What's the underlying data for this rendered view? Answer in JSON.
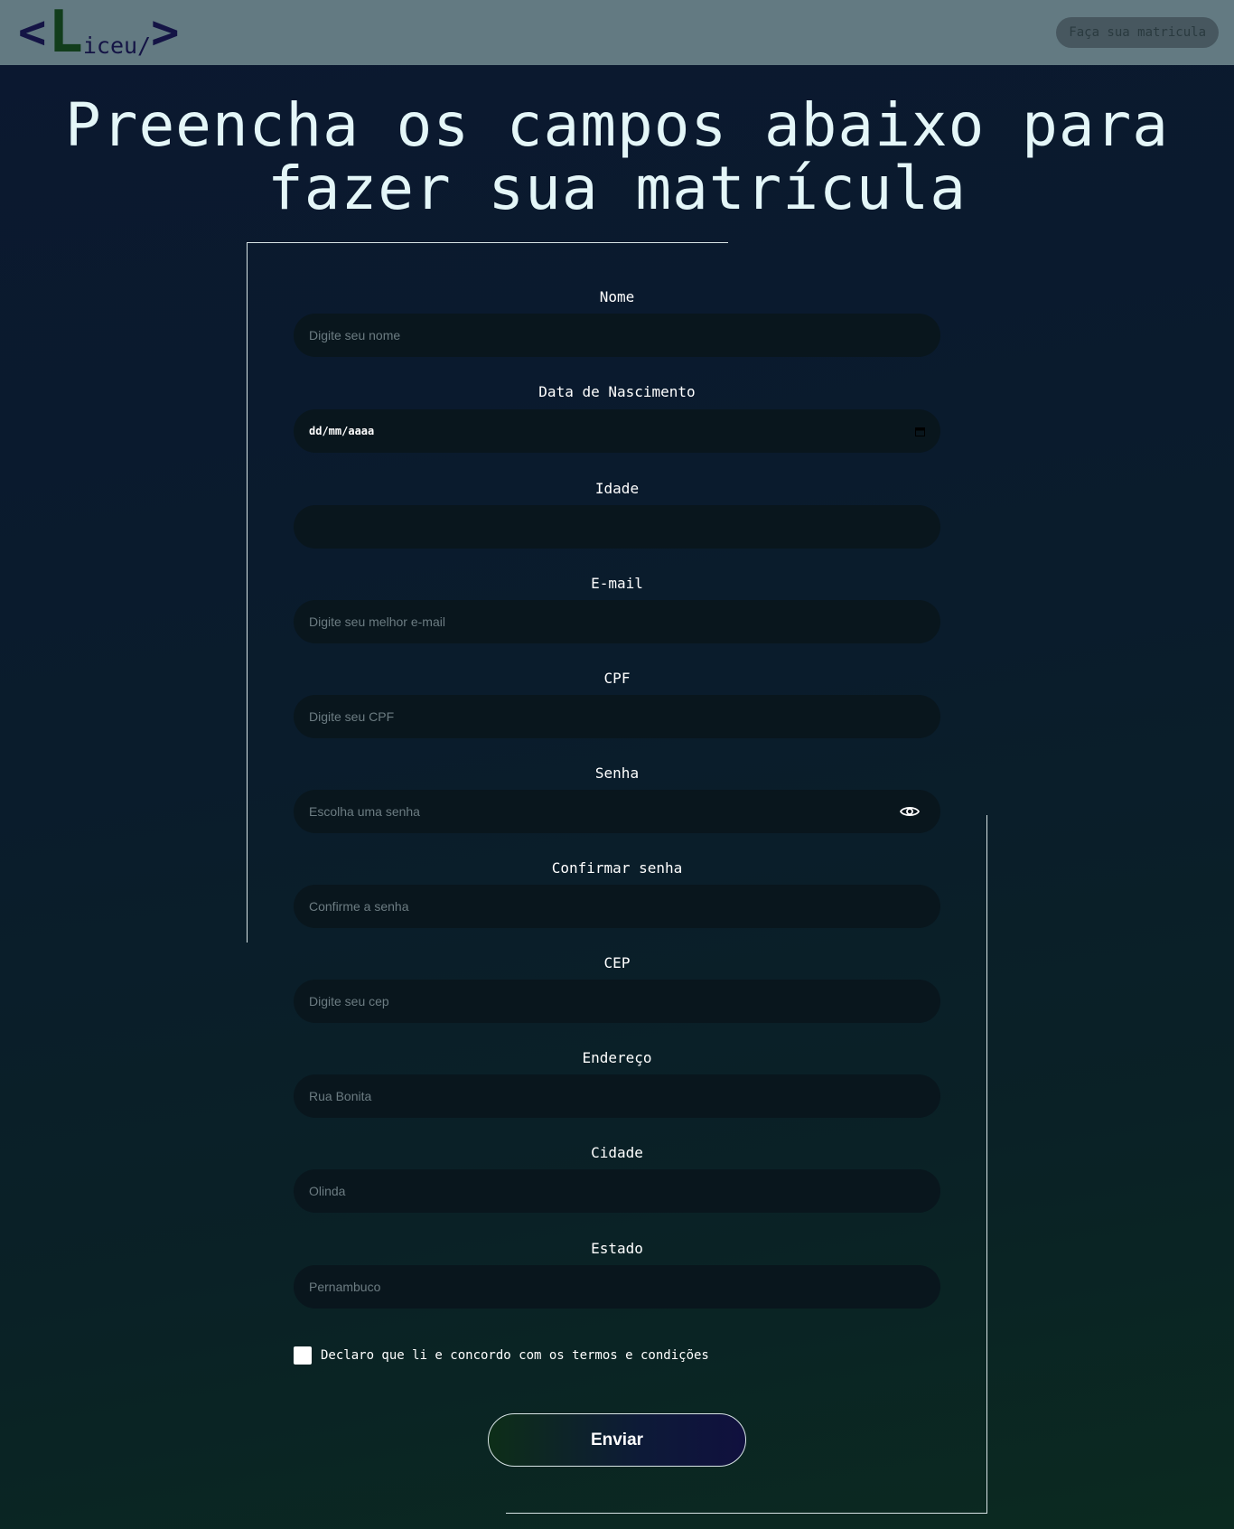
{
  "nav": {
    "logo_open": "<",
    "logo_L": "L",
    "logo_rest": "iceu/",
    "logo_close": ">",
    "cta_label": "Faça sua matricula"
  },
  "page": {
    "title_line1": "Preencha os campos abaixo para",
    "title_line2": "fazer sua matrícula"
  },
  "form": {
    "nome": {
      "label": "Nome",
      "placeholder": "Digite seu nome"
    },
    "nascimento": {
      "label": "Data de Nascimento",
      "value": "dd/mm/aaaa"
    },
    "idade": {
      "label": "Idade",
      "placeholder": ""
    },
    "email": {
      "label": "E-mail",
      "placeholder": "Digite seu melhor e-mail"
    },
    "cpf": {
      "label": "CPF",
      "placeholder": "Digite seu CPF"
    },
    "senha": {
      "label": "Senha",
      "placeholder": "Escolha uma senha"
    },
    "confirmar": {
      "label": "Confirmar senha",
      "placeholder": "Confirme a senha"
    },
    "cep": {
      "label": "CEP",
      "placeholder": "Digite seu cep"
    },
    "endereco": {
      "label": "Endereço",
      "placeholder": "Rua Bonita"
    },
    "cidade": {
      "label": "Cidade",
      "placeholder": "Olinda"
    },
    "estado": {
      "label": "Estado",
      "placeholder": "Pernambuco"
    },
    "terms_label": "Declaro que li e concordo com os termos e condições",
    "submit_label": "Enviar"
  },
  "icons": {
    "calendar": "calendar-icon",
    "password_toggle": "eye-icon"
  },
  "colors": {
    "navbar": "#637a82",
    "logo_bracket": "#141445",
    "logo_L": "#123d1c",
    "field_bg": "#09161d"
  }
}
